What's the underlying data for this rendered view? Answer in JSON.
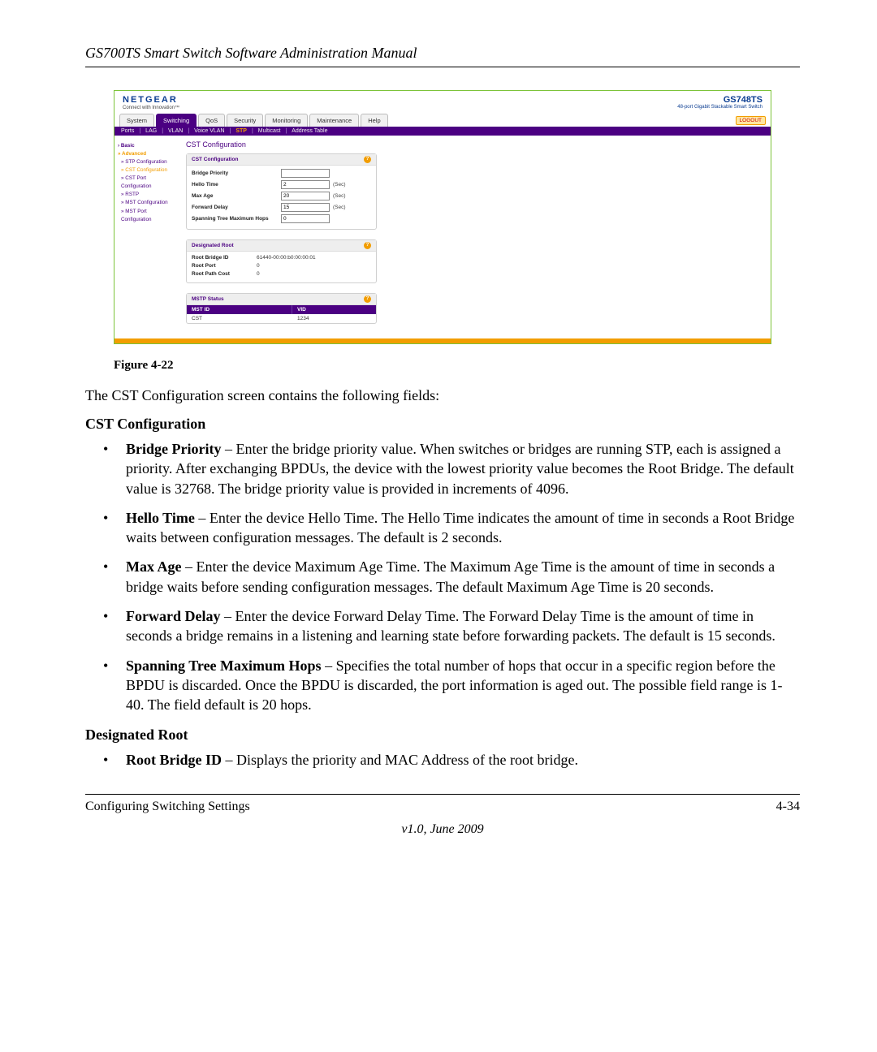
{
  "doc": {
    "header": "GS700TS Smart Switch Software Administration Manual",
    "figure_label": "Figure 4-22",
    "lead": "The CST Configuration screen contains the following fields:",
    "section_a": "CST Configuration",
    "section_b": "Designated Root",
    "bullets_a": [
      {
        "term": "Bridge Priority",
        "dash": " – ",
        "text": "Enter the bridge priority value. When switches or bridges are running STP, each is assigned a priority. After exchanging BPDUs, the device with the lowest priority value becomes the Root Bridge. The default value is 32768. The bridge priority value is provided in increments of 4096."
      },
      {
        "term": "Hello Time",
        "dash": " – ",
        "text": "Enter the device Hello Time. The Hello Time indicates the amount of time in seconds a Root Bridge waits between configuration messages. The default is 2 seconds."
      },
      {
        "term": "Max Age",
        "dash": " – ",
        "text": "Enter the device Maximum Age Time. The Maximum Age Time is the amount of time in seconds a bridge waits before sending configuration messages. The default Maximum Age Time is 20 seconds."
      },
      {
        "term": "Forward Delay",
        "dash": " – ",
        "text": "Enter the device Forward Delay Time. The Forward Delay Time is the amount of time in seconds a bridge remains in a listening and learning state before forwarding packets. The default is 15 seconds."
      },
      {
        "term": "Spanning Tree Maximum Hops",
        "dash": " – ",
        "text": "Specifies the total number of hops that occur in a specific region before the BPDU is discarded. Once the BPDU is discarded, the port information is aged out. The possible field range is 1-40. The field default is 20 hops."
      }
    ],
    "bullets_b": [
      {
        "term": "Root Bridge ID",
        "dash": " – ",
        "text": "Displays the priority and MAC Address of the root bridge."
      }
    ],
    "footer_left": "Configuring Switching Settings",
    "footer_right": "4-34",
    "version": "v1.0, June 2009"
  },
  "ss": {
    "brand": "NETGEAR",
    "tagline": "Connect with Innovation™",
    "model": "GS748TS",
    "model_sub": "48-port Gigabit Stackable Smart Switch",
    "tabs": [
      "System",
      "Switching",
      "QoS",
      "Security",
      "Monitoring",
      "Maintenance",
      "Help"
    ],
    "tab_active": "Switching",
    "logout": "LOGOUT",
    "subnav": [
      "Ports",
      "LAG",
      "VLAN",
      "Voice VLAN",
      "STP",
      "Multicast",
      "Address Table"
    ],
    "subnav_active": "STP",
    "sidebar": {
      "basic": "Basic",
      "advanced": "Advanced",
      "items": [
        "STP Configuration",
        "CST Configuration",
        "CST Port Configuration",
        "RSTP",
        "MST Configuration",
        "MST Port Configuration"
      ],
      "active": "CST Configuration"
    },
    "pagetitle": "CST Configuration",
    "cst_panel": {
      "head": "CST Configuration",
      "rows": {
        "bridge_priority": {
          "label": "Bridge Priority",
          "value": ""
        },
        "hello_time": {
          "label": "Hello Time",
          "value": "2",
          "unit": "(Sec)"
        },
        "max_age": {
          "label": "Max Age",
          "value": "20",
          "unit": "(Sec)"
        },
        "forward_delay": {
          "label": "Forward Delay",
          "value": "15",
          "unit": "(Sec)"
        },
        "max_hops": {
          "label": "Spanning Tree Maximum Hops",
          "value": "0"
        }
      }
    },
    "root_panel": {
      "head": "Designated Root",
      "rows": {
        "root_bridge_id": {
          "label": "Root Bridge ID",
          "value": "61440-00:00:b0:00:00:01"
        },
        "root_port": {
          "label": "Root Port",
          "value": "0"
        },
        "root_path_cost": {
          "label": "Root Path Cost",
          "value": "0"
        }
      }
    },
    "mstp_panel": {
      "head": "MSTP Status",
      "col1": "MST ID",
      "col2": "VID",
      "row": {
        "mst": "CST",
        "vid": "1234"
      }
    }
  }
}
